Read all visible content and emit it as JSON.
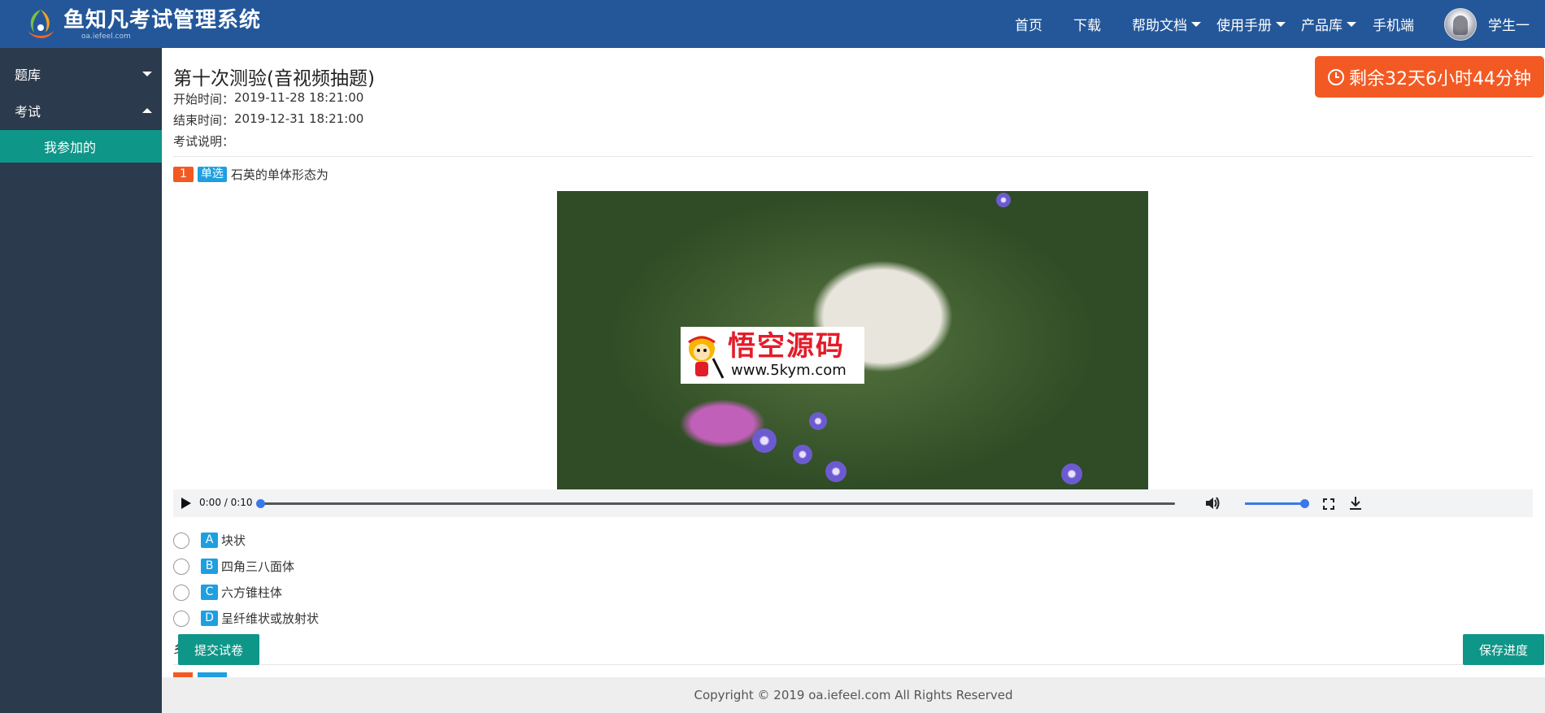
{
  "header": {
    "logo_title": "鱼知凡考试管理系统",
    "logo_sub": "oa.iefeel.com",
    "nav": [
      {
        "label": "首页",
        "has_caret": false
      },
      {
        "label": "下载",
        "has_caret": false
      },
      {
        "label": "帮助文档",
        "has_caret": true
      },
      {
        "label": "使用手册",
        "has_caret": true
      },
      {
        "label": "产品库",
        "has_caret": true
      },
      {
        "label": "手机端",
        "has_caret": false
      }
    ],
    "user_name": "学生一"
  },
  "sidebar": {
    "items": [
      {
        "label": "题库",
        "expanded": false
      },
      {
        "label": "考试",
        "expanded": true
      }
    ],
    "active_sub": "我参加的"
  },
  "exam": {
    "title": "第十次测验(音视频抽题)",
    "start_label": "开始时间：",
    "start_time": "2019-11-28 18:21:00",
    "end_label": "结束时间：",
    "end_time": "2019-12-31 18:21:00",
    "desc_label": "考试说明：",
    "countdown": "剩余32天6小时44分钟"
  },
  "question": {
    "number": "1",
    "type": "单选",
    "text": "石英的单体形态为",
    "watermark_title": "悟空源码",
    "watermark_url": "www.5kym.com",
    "player_time": "0:00 / 0:10",
    "progress": 0.0,
    "volume": 1.0,
    "options": [
      {
        "letter": "A",
        "text": "块状"
      },
      {
        "letter": "B",
        "text": "四角三八面体"
      },
      {
        "letter": "C",
        "text": "六方锥柱体"
      },
      {
        "letter": "D",
        "text": "呈纤维状或放射状"
      }
    ]
  },
  "actions": {
    "submit": "提交试卷",
    "save": "保存进度",
    "partial_char": "乡"
  },
  "footer": {
    "copyright": "Copyright © 2019 oa.iefeel.com All Rights Reserved"
  },
  "colors": {
    "header_bg": "#23579a",
    "sidebar_bg": "#2b3a4d",
    "accent_teal": "#0e9688",
    "accent_orange": "#f35a23",
    "badge_blue": "#1e9fe0"
  }
}
